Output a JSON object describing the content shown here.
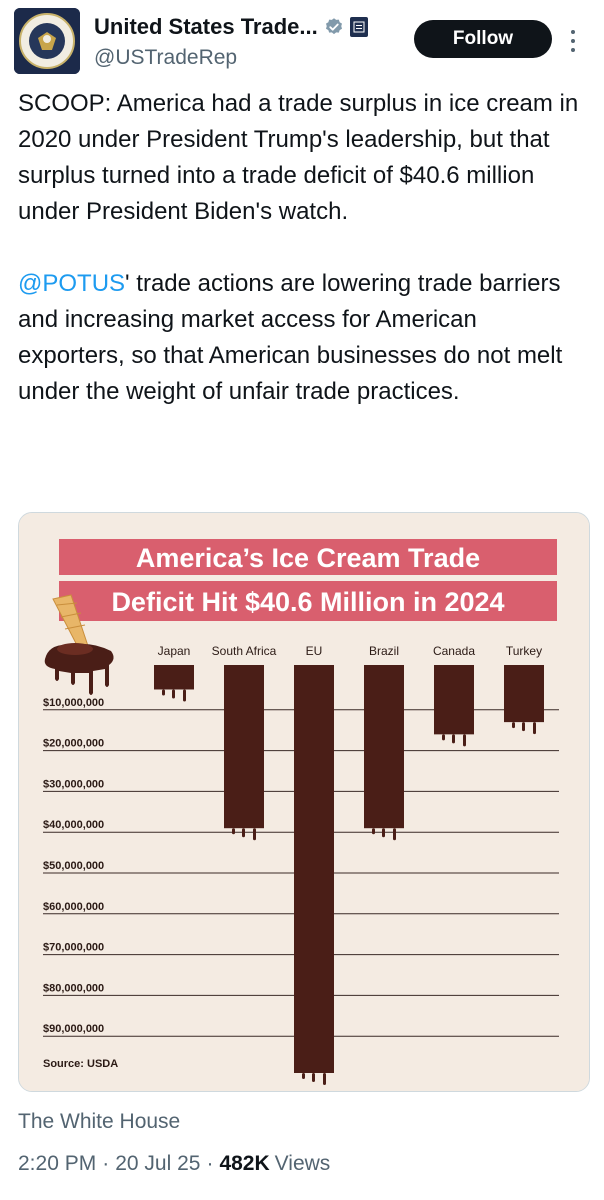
{
  "account": {
    "name": "United States Trade...",
    "handle": "@USTradeRep",
    "follow_label": "Follow",
    "colors": {
      "verified": "#829aab",
      "accent": "#1d9bf0"
    }
  },
  "tweet": {
    "para1": "SCOOP: America had a trade surplus in ice cream in 2020 under President Trump's leadership, but that surplus turned into a trade deficit of $40.6 million under President Biden's watch.",
    "mention": "@POTUS",
    "para2_rest": "' trade actions are lowering trade barriers and increasing market access for American exporters, so that American businesses do not melt under the weight of unfair trade practices."
  },
  "chart_data": {
    "type": "bar",
    "title_line1": "America’s Ice Cream Trade",
    "title_line2": "Deficit Hit $40.6 Million in 2024",
    "categories": [
      "Japan",
      "South Africa",
      "EU",
      "Brazil",
      "Canada",
      "Turkey"
    ],
    "values": [
      6000000,
      40000000,
      100000000,
      40000000,
      17000000,
      14000000
    ],
    "ytick_labels": [
      "$10,000,000",
      "$20,000,000",
      "$30,000,000",
      "$40,000,000",
      "$50,000,000",
      "$60,000,000",
      "$70,000,000",
      "$80,000,000",
      "$90,000,000"
    ],
    "ytick_values": [
      10000000,
      20000000,
      30000000,
      40000000,
      50000000,
      60000000,
      70000000,
      80000000,
      90000000
    ],
    "ylim": [
      0,
      100000000
    ],
    "y_inverted": true,
    "source": "Source: USDA",
    "colors": {
      "bar": "#4a1e17",
      "banner": "#d95f6e",
      "background": "#f4ebe2"
    }
  },
  "footer": {
    "source": "The White House",
    "time": "2:20 PM",
    "date": "20 Jul 25",
    "views_count": "482K",
    "views_label": "Views"
  }
}
